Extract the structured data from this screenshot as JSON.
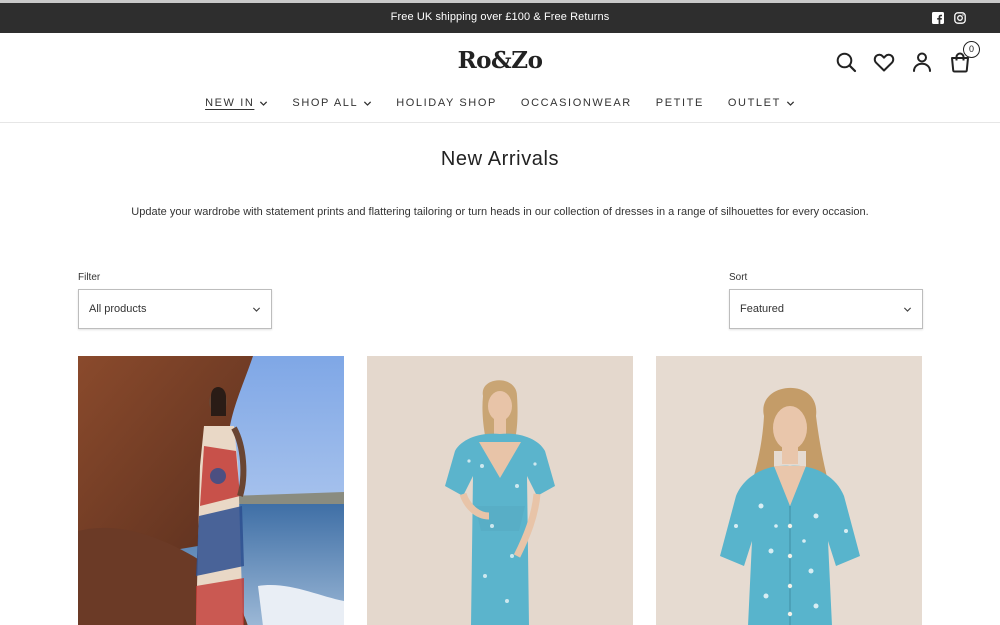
{
  "announcement": {
    "text": "Free UK shipping over £100 & Free Returns"
  },
  "social": [
    "facebook-icon",
    "instagram-icon"
  ],
  "brand": {
    "logo": "Ro&Zo"
  },
  "header": {
    "icons": [
      "search-icon",
      "heart-icon",
      "account-icon",
      "cart-icon"
    ],
    "cart_count": "0"
  },
  "nav": [
    {
      "label": "NEW IN",
      "has_dropdown": true,
      "active": true
    },
    {
      "label": "SHOP ALL",
      "has_dropdown": true,
      "active": false
    },
    {
      "label": "HOLIDAY SHOP",
      "has_dropdown": false,
      "active": false
    },
    {
      "label": "OCCASIONWEAR",
      "has_dropdown": false,
      "active": false
    },
    {
      "label": "PETITE",
      "has_dropdown": false,
      "active": false
    },
    {
      "label": "OUTLET",
      "has_dropdown": true,
      "active": false
    }
  ],
  "page": {
    "title": "New Arrivals",
    "description": "Update your wardrobe with statement prints and flattering tailoring or turn heads in our collection of dresses in a range of silhouettes for every occasion."
  },
  "filter": {
    "label": "Filter",
    "value": "All products"
  },
  "sort": {
    "label": "Sort",
    "value": "Featured"
  },
  "products": [
    {
      "image": "woman in patterned maxi dress by seaside rocks"
    },
    {
      "image": "woman in turquoise floral wrap midi dress"
    },
    {
      "image": "woman in turquoise floral button-front dress"
    }
  ],
  "colors": {
    "announcement_bg": "#2e2e2e",
    "text": "#222222",
    "product_backdrop": "#e4d8cd"
  }
}
